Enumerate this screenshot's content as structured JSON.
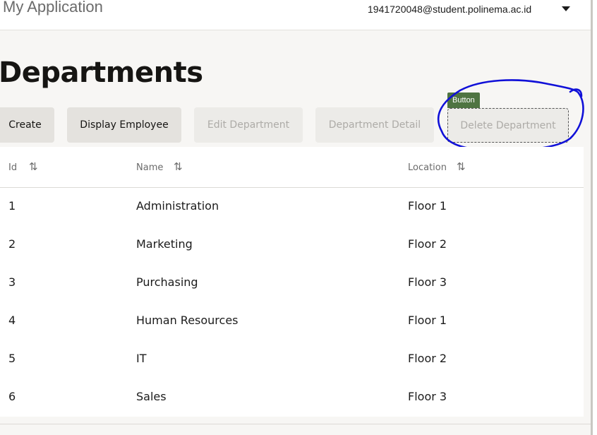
{
  "header": {
    "app_title": "My Application",
    "user_email": "1941720048@student.polinema.ac.id",
    "user_menu_icon": "caret-down-icon"
  },
  "page": {
    "title": "Departments"
  },
  "toolbar": {
    "create_label": "Create",
    "display_employee_label": "Display Employee",
    "edit_department_label": "Edit Department",
    "department_detail_label": "Department Detail",
    "delete_department_label": "Delete Department",
    "tooltip_label": "Button"
  },
  "table": {
    "columns": [
      {
        "label": "Id",
        "sort_icon": "⇅"
      },
      {
        "label": "Name",
        "sort_icon": "⇅"
      },
      {
        "label": "Location",
        "sort_icon": "⇅"
      }
    ],
    "rows": [
      {
        "id": "1",
        "name": "Administration",
        "location": "Floor 1"
      },
      {
        "id": "2",
        "name": "Marketing",
        "location": "Floor 2"
      },
      {
        "id": "3",
        "name": "Purchasing",
        "location": "Floor 3"
      },
      {
        "id": "4",
        "name": "Human Resources",
        "location": "Floor 1"
      },
      {
        "id": "5",
        "name": "IT",
        "location": "Floor 2"
      },
      {
        "id": "6",
        "name": "Sales",
        "location": "Floor 3"
      }
    ]
  },
  "colors": {
    "tooltip_bg": "#4f7442",
    "annotation_ring": "#1010d8"
  }
}
